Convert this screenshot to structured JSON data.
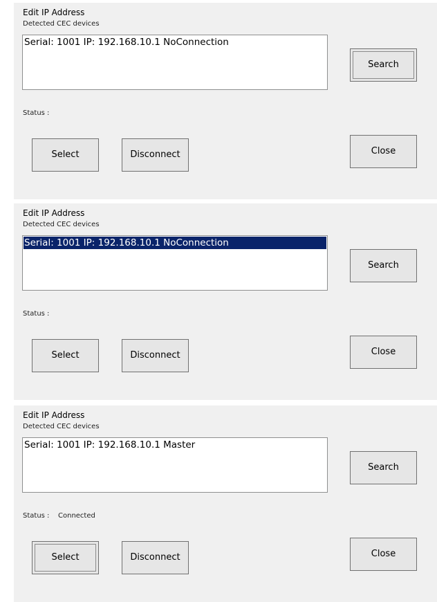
{
  "panels": [
    {
      "title": "Edit IP Address",
      "subtitle": "Detected CEC devices",
      "list_item": "Serial: 1001 IP: 192.168.10.1 NoConnection",
      "list_item_selected": false,
      "status_label": "Status :",
      "status_value": "",
      "focused_button": "search",
      "buttons": {
        "search": "Search",
        "select": "Select",
        "disconnect": "Disconnect",
        "close": "Close"
      }
    },
    {
      "title": "Edit IP Address",
      "subtitle": "Detected CEC devices",
      "list_item": "Serial: 1001 IP: 192.168.10.1 NoConnection",
      "list_item_selected": true,
      "status_label": "Status :",
      "status_value": "",
      "focused_button": "none",
      "buttons": {
        "search": "Search",
        "select": "Select",
        "disconnect": "Disconnect",
        "close": "Close"
      }
    },
    {
      "title": "Edit IP Address",
      "subtitle": "Detected CEC devices",
      "list_item": "Serial: 1001 IP: 192.168.10.1 Master",
      "list_item_selected": false,
      "status_label": "Status :",
      "status_value": "Connected",
      "focused_button": "select",
      "buttons": {
        "search": "Search",
        "select": "Select",
        "disconnect": "Disconnect",
        "close": "Close"
      }
    }
  ],
  "colors": {
    "panel_background": "#f0f0f0",
    "selection_background": "#0a246a",
    "selection_text": "#ffffff",
    "button_face": "#e6e6e6"
  }
}
